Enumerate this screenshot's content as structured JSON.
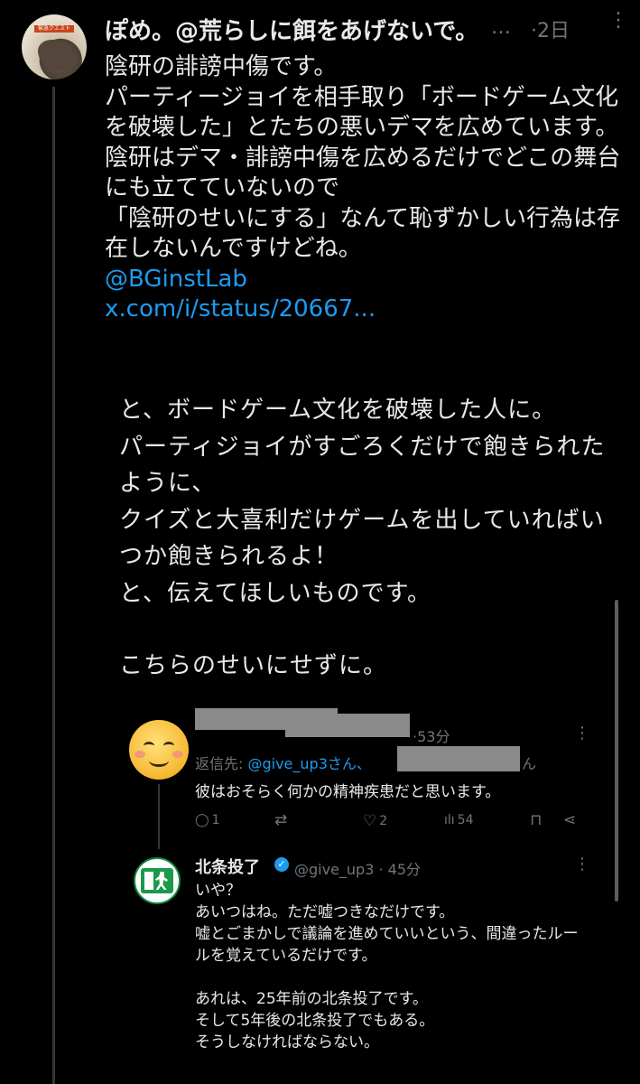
{
  "main_post": {
    "avatar_banner": "緊急クエスト",
    "display_name": "ぽめ。@荒らしに餌をあげないで。",
    "more": "…",
    "time": "·2日",
    "menu": "⋮",
    "lines": [
      "陰研の誹謗中傷です。",
      "パーティージョイを相手取り「ボードゲーム文化を破壊した」とたちの悪いデマを広めています。",
      "陰研はデマ・誹謗中傷を広めるだけでどこの舞台にも立てていないので",
      "「陰研のせいにする」なんて恥ずかしい行為は存在しないんですけどね。"
    ],
    "mention": "@BGinstLab",
    "url": "x.com/i/status/20667..."
  },
  "quoted_text": [
    "と、ボードゲーム文化を破壊した人に。",
    "パーティジョイがすごろくだけで飽きられたように、",
    "クイズと大喜利だけゲームを出していればいつか飽きられるよ！",
    "と、伝えてほしいものです。",
    "",
    "こちらのせいにせずに。"
  ],
  "reply1": {
    "time": "·53分",
    "menu": "⋮",
    "reply_to_prefix": "返信先: ",
    "reply_to_handle": "@give_up3さん、",
    "reply_to_suffix": "ん",
    "text": "彼はおそらく何かの精神疾患だと思います。",
    "actions": {
      "reply_icon": "◯",
      "reply_count": "1",
      "retweet_icon": "⇄",
      "like_icon": "♡",
      "like_count": "2",
      "views_icon": "ılı",
      "views_count": "54",
      "bookmark_icon": "⊓",
      "share_icon": "⋖"
    }
  },
  "reply2": {
    "display_name": "北条投了",
    "verified_icon": "✓",
    "handle_time": "@give_up3 · 45分",
    "menu": "⋮",
    "lines": [
      "いや？",
      "あいつはね。ただ嘘つきなだけです。",
      "嘘とごまかしで議論を進めていいという、間違ったルールを覚えているだけです。",
      "",
      "あれは、25年前の北条投了です。",
      "そして5年後の北条投了でもある。",
      "そうしなければならない。"
    ]
  }
}
